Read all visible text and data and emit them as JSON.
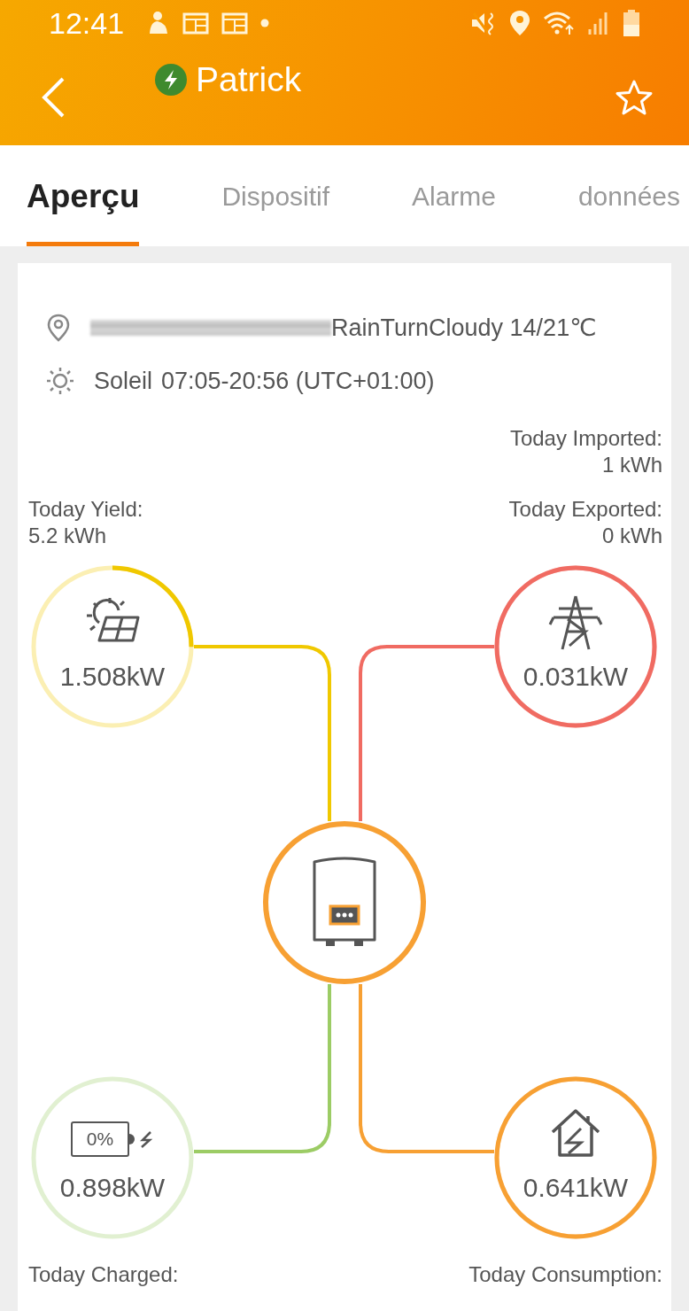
{
  "status_bar": {
    "time": "12:41"
  },
  "header": {
    "title": "Patrick",
    "favorite": false
  },
  "tabs": [
    {
      "label": "Aperçu",
      "selected": true
    },
    {
      "label": "Dispositif",
      "selected": false
    },
    {
      "label": "Alarme",
      "selected": false
    },
    {
      "label": "données",
      "selected": false
    }
  ],
  "weather": {
    "conditions": "RainTurnCloudy 14/21℃"
  },
  "sun": {
    "label": "Soleil",
    "hours": "07:05-20:56 (UTC+01:00)"
  },
  "inverter": {
    "color": "#f7a033"
  },
  "nodes": [
    {
      "kind": "solar",
      "reading": "1.508kW",
      "color": "#f0c800",
      "stats": [
        {
          "label": "Today Yield:",
          "value": "5.2 kWh"
        }
      ]
    },
    {
      "kind": "grid",
      "reading": "0.031kW",
      "color": "#f06b62",
      "stats": [
        {
          "label": "Today Imported:",
          "value": "1 kWh"
        },
        {
          "label": "Today Exported:",
          "value": "0 kWh"
        }
      ]
    },
    {
      "kind": "battery",
      "reading": "0.898kW",
      "charge": "0%",
      "color": "#9ccc65",
      "stats": [
        {
          "label": "Today Charged:"
        }
      ]
    },
    {
      "kind": "home",
      "reading": "0.641kW",
      "color": "#f7a033",
      "stats": [
        {
          "label": "Today Consumption:"
        }
      ]
    }
  ]
}
